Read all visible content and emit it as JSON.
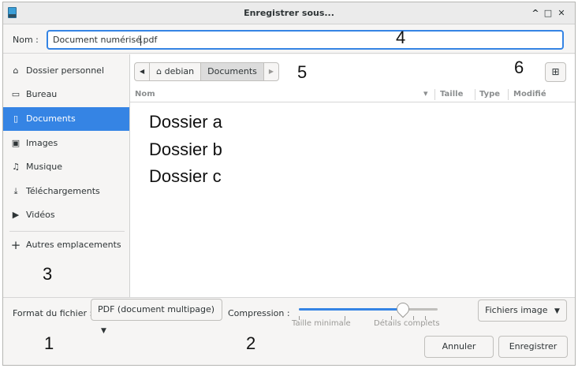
{
  "window": {
    "title": "Enregistrer sous...",
    "controls": [
      "^",
      "□",
      "✕"
    ]
  },
  "name": {
    "label": "Nom :",
    "value_before_caret": "Document numérisé",
    "value_after_caret": ".pdf"
  },
  "sidebar": {
    "items": [
      {
        "label": "Dossier personnel",
        "icon": "⌂"
      },
      {
        "label": "Bureau",
        "icon": "▭"
      },
      {
        "label": "Documents",
        "icon": "▯"
      },
      {
        "label": "Images",
        "icon": "▣"
      },
      {
        "label": "Musique",
        "icon": "♫"
      },
      {
        "label": "Téléchargements",
        "icon": "⤓"
      },
      {
        "label": "Vidéos",
        "icon": "▶"
      }
    ],
    "other_locations": {
      "label": "Autres emplacements",
      "icon": "+"
    }
  },
  "pathbar": {
    "back": "◀",
    "home_icon": "⌂",
    "home": "debian",
    "current": "Documents",
    "forward": "▶"
  },
  "new_folder_icon": "⊞",
  "columns": {
    "name": "Nom",
    "sort": "▾",
    "size": "Taille",
    "type": "Type",
    "modified": "Modifié"
  },
  "files": [
    "Dossier a",
    "Dossier b",
    "Dossier c"
  ],
  "annotations": [
    "1",
    "2",
    "3",
    "4",
    "5",
    "6"
  ],
  "bottom": {
    "format_label": "Format du fichier :",
    "format_value": "PDF (document multipage)",
    "dropdown_icon": "▼",
    "compression_label": "Compression :",
    "compression_value": 0.75,
    "min_label": "Taille minimale",
    "max_label": "Détails complets",
    "filter_value": "Fichiers image",
    "cancel": "Annuler",
    "save": "Enregistrer"
  },
  "colors": {
    "accent": "#3584e4"
  }
}
